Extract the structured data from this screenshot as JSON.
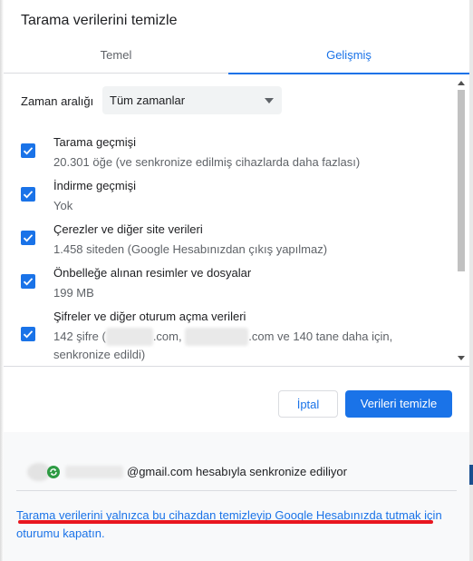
{
  "dialog": {
    "title": "Tarama verilerini temizle"
  },
  "tabs": [
    {
      "label": "Temel",
      "active": false
    },
    {
      "label": "Gelişmiş",
      "active": true
    }
  ],
  "time_range": {
    "label": "Zaman aralığı",
    "selected": "Tüm zamanlar"
  },
  "items": [
    {
      "title": "Tarama geçmişi",
      "description": "20.301 öğe (ve senkronize edilmiş cihazlarda daha fazlası)",
      "checked": true
    },
    {
      "title": "İndirme geçmişi",
      "description": "Yok",
      "checked": true
    },
    {
      "title": "Çerezler ve diğer site verileri",
      "description": "1.458 siteden (Google Hesabınızdan çıkış yapılmaz)",
      "checked": true
    },
    {
      "title": "Önbelleğe alınan resimler ve dosyalar",
      "description": "199 MB",
      "checked": true
    },
    {
      "title": "Şifreler ve diğer oturum açma verileri",
      "description_prefix": "142 şifre (",
      "description_mid": ".com,",
      "description_suffix": ".com ve 140 tane daha için,",
      "description_line2": "senkronize edildi)",
      "checked": true
    }
  ],
  "buttons": {
    "cancel": "İptal",
    "confirm": "Verileri temizle"
  },
  "account": {
    "sync_text": "@gmail.com hesabıyla senkronize ediliyor"
  },
  "footer": {
    "signout_link": "Tarama verilerini yalnızca bu cihazdan temizleyip Google Hesabınızda tutmak için oturumu kapatın."
  },
  "colors": {
    "accent": "#1a73e8",
    "annotation": "#e8161f",
    "sync": "#2e9b44"
  }
}
